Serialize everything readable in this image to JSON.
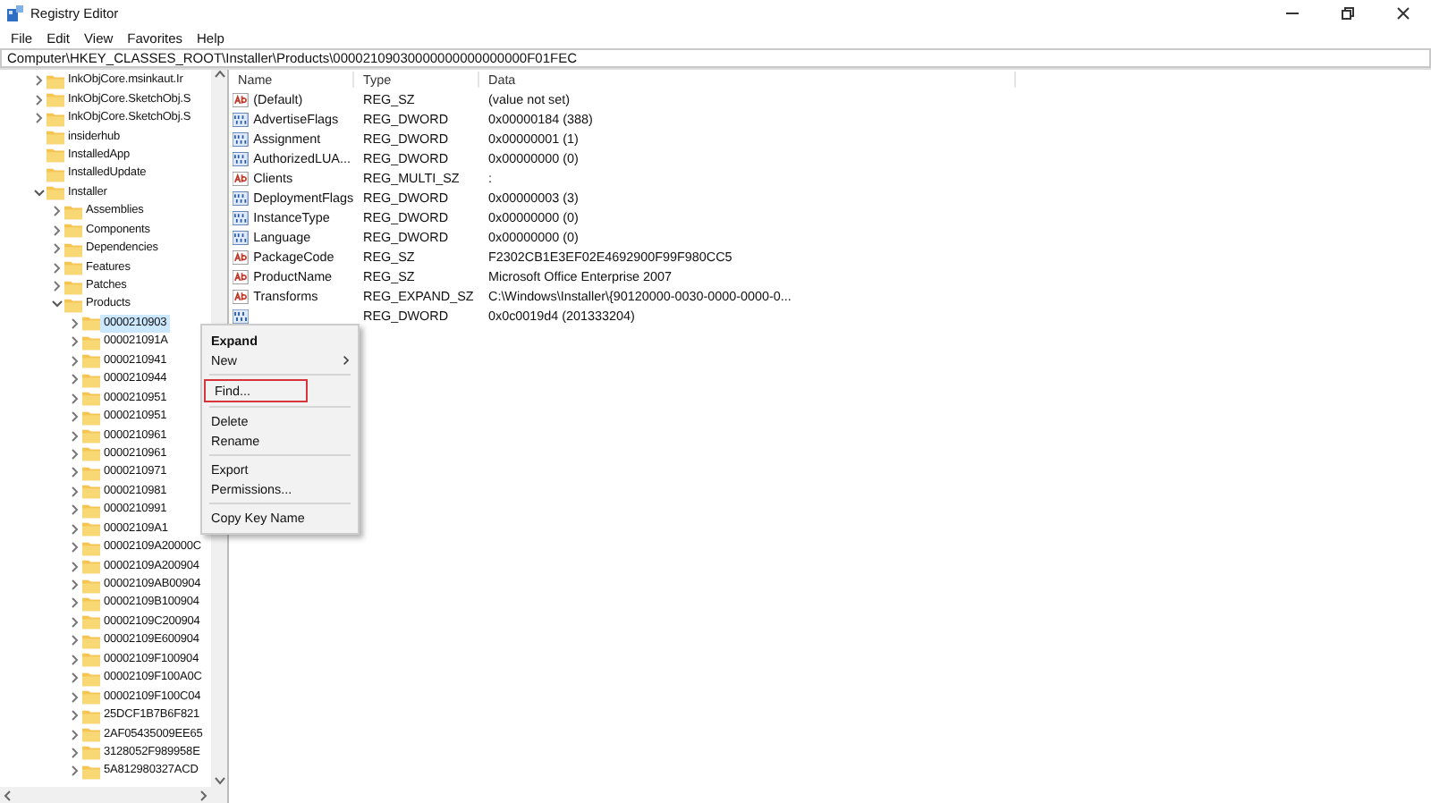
{
  "window": {
    "title": "Registry Editor"
  },
  "menu": [
    "File",
    "Edit",
    "View",
    "Favorites",
    "Help"
  ],
  "address": "Computer\\HKEY_CLASSES_ROOT\\Installer\\Products\\00002109030000000000000000F01FEC",
  "tree": [
    {
      "label": "InkObjCore.msinkaut.Ir",
      "expandable": true,
      "expanded": false,
      "selected": false
    },
    {
      "label": "InkObjCore.SketchObj.S",
      "expandable": true,
      "expanded": false,
      "selected": false
    },
    {
      "label": "InkObjCore.SketchObj.S",
      "expandable": true,
      "expanded": false,
      "selected": false
    },
    {
      "label": "insiderhub",
      "expandable": false,
      "selected": false
    },
    {
      "label": "InstalledApp",
      "expandable": false,
      "selected": false
    },
    {
      "label": "InstalledUpdate",
      "expandable": false,
      "selected": false
    },
    {
      "label": "Installer",
      "expandable": true,
      "expanded": true,
      "selected": false,
      "children": [
        {
          "label": "Assemblies",
          "expandable": true,
          "expanded": false,
          "selected": false
        },
        {
          "label": "Components",
          "expandable": true,
          "expanded": false,
          "selected": false
        },
        {
          "label": "Dependencies",
          "expandable": true,
          "expanded": false,
          "selected": false
        },
        {
          "label": "Features",
          "expandable": true,
          "expanded": false,
          "selected": false
        },
        {
          "label": "Patches",
          "expandable": true,
          "expanded": false,
          "selected": false
        },
        {
          "label": "Products",
          "expandable": true,
          "expanded": true,
          "selected": false,
          "children": [
            {
              "label": "0000210903",
              "expandable": true,
              "expanded": false,
              "selected": true
            },
            {
              "label": "000021091A",
              "expandable": true,
              "expanded": false,
              "selected": false
            },
            {
              "label": "0000210941",
              "expandable": true,
              "expanded": false,
              "selected": false
            },
            {
              "label": "0000210944",
              "expandable": true,
              "expanded": false,
              "selected": false
            },
            {
              "label": "0000210951",
              "expandable": true,
              "expanded": false,
              "selected": false
            },
            {
              "label": "0000210951",
              "expandable": true,
              "expanded": false,
              "selected": false
            },
            {
              "label": "0000210961",
              "expandable": true,
              "expanded": false,
              "selected": false
            },
            {
              "label": "0000210961",
              "expandable": true,
              "expanded": false,
              "selected": false
            },
            {
              "label": "0000210971",
              "expandable": true,
              "expanded": false,
              "selected": false
            },
            {
              "label": "0000210981",
              "expandable": true,
              "expanded": false,
              "selected": false
            },
            {
              "label": "0000210991",
              "expandable": true,
              "expanded": false,
              "selected": false
            },
            {
              "label": "00002109A1",
              "expandable": true,
              "expanded": false,
              "selected": false
            },
            {
              "label": "00002109A20000C",
              "expandable": true,
              "expanded": false,
              "selected": false
            },
            {
              "label": "00002109A200904",
              "expandable": true,
              "expanded": false,
              "selected": false
            },
            {
              "label": "00002109AB00904",
              "expandable": true,
              "expanded": false,
              "selected": false
            },
            {
              "label": "00002109B100904",
              "expandable": true,
              "expanded": false,
              "selected": false
            },
            {
              "label": "00002109C200904",
              "expandable": true,
              "expanded": false,
              "selected": false
            },
            {
              "label": "00002109E600904",
              "expandable": true,
              "expanded": false,
              "selected": false
            },
            {
              "label": "00002109F100904",
              "expandable": true,
              "expanded": false,
              "selected": false
            },
            {
              "label": "00002109F100A0C",
              "expandable": true,
              "expanded": false,
              "selected": false
            },
            {
              "label": "00002109F100C04",
              "expandable": true,
              "expanded": false,
              "selected": false
            },
            {
              "label": "25DCF1B7B6F821",
              "expandable": true,
              "expanded": false,
              "selected": false
            },
            {
              "label": "2AF05435009EE65",
              "expandable": true,
              "expanded": false,
              "selected": false
            },
            {
              "label": "3128052F989958E",
              "expandable": true,
              "expanded": false,
              "selected": false
            },
            {
              "label": "5A812980327ACD",
              "expandable": true,
              "expanded": false,
              "selected": false
            }
          ]
        }
      ]
    }
  ],
  "values": {
    "columns": [
      "Name",
      "Type",
      "Data"
    ],
    "rows": [
      {
        "kind": "string",
        "name": "(Default)",
        "type": "REG_SZ",
        "data": "(value not set)"
      },
      {
        "kind": "binary",
        "name": "AdvertiseFlags",
        "type": "REG_DWORD",
        "data": "0x00000184 (388)"
      },
      {
        "kind": "binary",
        "name": "Assignment",
        "type": "REG_DWORD",
        "data": "0x00000001 (1)"
      },
      {
        "kind": "binary",
        "name": "AuthorizedLUA...",
        "type": "REG_DWORD",
        "data": "0x00000000 (0)"
      },
      {
        "kind": "string",
        "name": "Clients",
        "type": "REG_MULTI_SZ",
        "data": ":"
      },
      {
        "kind": "binary",
        "name": "DeploymentFlags",
        "type": "REG_DWORD",
        "data": "0x00000003 (3)"
      },
      {
        "kind": "binary",
        "name": "InstanceType",
        "type": "REG_DWORD",
        "data": "0x00000000 (0)"
      },
      {
        "kind": "binary",
        "name": "Language",
        "type": "REG_DWORD",
        "data": "0x00000000 (0)"
      },
      {
        "kind": "string",
        "name": "PackageCode",
        "type": "REG_SZ",
        "data": "F2302CB1E3EF02E4692900F99F980CC5"
      },
      {
        "kind": "string",
        "name": "ProductName",
        "type": "REG_SZ",
        "data": "Microsoft Office Enterprise 2007"
      },
      {
        "kind": "string",
        "name": "Transforms",
        "type": "REG_EXPAND_SZ",
        "data": "C:\\Windows\\Installer\\{90120000-0030-0000-0000-0..."
      },
      {
        "kind": "binary",
        "type": "REG_DWORD",
        "data": "0x0c0019d4 (201333204)"
      }
    ]
  },
  "context_menu": [
    {
      "kind": "item",
      "label": "Expand",
      "default": true,
      "submenu": false,
      "highlighted": false
    },
    {
      "kind": "item",
      "label": "New",
      "default": false,
      "submenu": true,
      "highlighted": false
    },
    {
      "kind": "separator"
    },
    {
      "kind": "item",
      "label": "Find...",
      "default": false,
      "submenu": false,
      "highlighted": true
    },
    {
      "kind": "separator"
    },
    {
      "kind": "item",
      "label": "Delete",
      "default": false,
      "submenu": false,
      "highlighted": false
    },
    {
      "kind": "item",
      "label": "Rename",
      "default": false,
      "submenu": false,
      "highlighted": false
    },
    {
      "kind": "separator"
    },
    {
      "kind": "item",
      "label": "Export",
      "default": false,
      "submenu": false,
      "highlighted": false
    },
    {
      "kind": "item",
      "label": "Permissions...",
      "default": false,
      "submenu": false,
      "highlighted": false
    },
    {
      "kind": "separator"
    },
    {
      "kind": "item",
      "label": "Copy Key Name",
      "default": false,
      "submenu": false,
      "highlighted": false
    }
  ]
}
